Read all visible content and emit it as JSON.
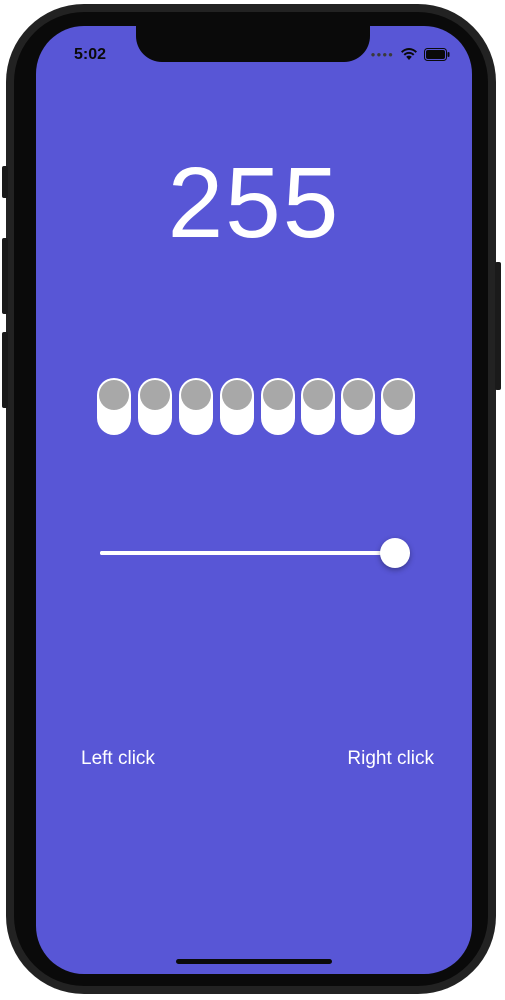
{
  "status_bar": {
    "time": "5:02",
    "signal_icon": "signal-dots-icon",
    "wifi_icon": "wifi-icon",
    "battery_icon": "battery-icon"
  },
  "counter": {
    "value": "255"
  },
  "bits": [
    {
      "label": "bit-7",
      "on": false
    },
    {
      "label": "bit-6",
      "on": false
    },
    {
      "label": "bit-5",
      "on": false
    },
    {
      "label": "bit-4",
      "on": false
    },
    {
      "label": "bit-3",
      "on": false
    },
    {
      "label": "bit-2",
      "on": false
    },
    {
      "label": "bit-1",
      "on": false
    },
    {
      "label": "bit-0",
      "on": false
    }
  ],
  "slider": {
    "value": 255,
    "min": 0,
    "max": 255
  },
  "buttons": {
    "left_label": "Left click",
    "right_label": "Right click"
  },
  "colors": {
    "background": "#5856d6",
    "foreground": "#ffffff",
    "toggle_knob": "#a8a8a8"
  }
}
